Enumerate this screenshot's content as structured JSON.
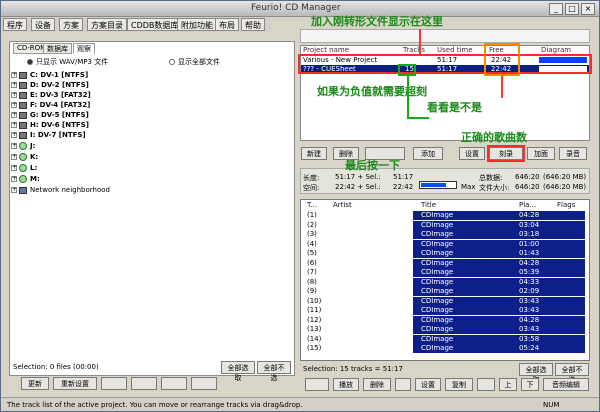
{
  "window_title": "Feurio! CD Manager",
  "menu": [
    "程序",
    "设备",
    "方案",
    "方案目录",
    "CDDB数据库",
    "附加功能",
    "布局",
    "帮助"
  ],
  "left_tabs": [
    "CD-ROM",
    "数据库",
    "观察"
  ],
  "left_options": [
    "只显示 WAV/MP3 文件",
    "显示全部文件"
  ],
  "drives": [
    {
      "letter": "C:",
      "label": "DV-1 [NTFS]"
    },
    {
      "letter": "D:",
      "label": "DV-2 [NTFS]"
    },
    {
      "letter": "E:",
      "label": "DV-3 [FAT32]"
    },
    {
      "letter": "F:",
      "label": "DV-4 [FAT32]"
    },
    {
      "letter": "G:",
      "label": "DV-5 [NTFS]"
    },
    {
      "letter": "H:",
      "label": "DV-6 [NTFS]"
    },
    {
      "letter": "I:",
      "label": "DV-7 [NTFS]"
    },
    {
      "letter": "J:",
      "label": ""
    },
    {
      "letter": "K:",
      "label": ""
    },
    {
      "letter": "L:",
      "label": ""
    },
    {
      "letter": "M:",
      "label": ""
    },
    {
      "letter": "Network neighborhood",
      "label": ""
    }
  ],
  "left_status": "Selection: 0 files (00:00)",
  "left_buttons": [
    "更新",
    "重新设置",
    "",
    "",
    "",
    "",
    "",
    "",
    "全部选取",
    "全部不选"
  ],
  "project_header": "Project name",
  "project_columns": [
    "Project name",
    "Tracks",
    "Used time",
    "Free",
    "Diagram"
  ],
  "project_rows": [
    {
      "name": "Various - New Project",
      "tracks": "",
      "used": "51:17",
      "free": "22:42"
    },
    {
      "name": "??? - CUESheet",
      "tracks": "15",
      "used": "51:17",
      "free": "22:42"
    }
  ],
  "mid_buttons": [
    "新建",
    "删除",
    "",
    "添加",
    "设置",
    "刻录",
    "加面",
    "录音"
  ],
  "mid_info": {
    "line1_label": "长度:",
    "line1_val": "51:17 + Sel.:",
    "line1_sel": "51:17",
    "line2_label": "空间:",
    "line2_val": "22:42 + Sel.:",
    "line2_sel": "22:42",
    "max_label": "Max",
    "r1_label": "总数据:",
    "r1_val": "646:20",
    "r1_unit": "(646:20 MB)",
    "r2_label": "文件大小:",
    "r2_val": "646:20",
    "r2_unit": "(646:20 MB)"
  },
  "track_columns": [
    "T...",
    "Artist",
    "Title",
    "Pla...",
    "Flags"
  ],
  "tracks": [
    {
      "n": "(1)",
      "title": "CDImage",
      "len": "04:28"
    },
    {
      "n": "(2)",
      "title": "CDImage",
      "len": "03:04"
    },
    {
      "n": "(3)",
      "title": "CDImage",
      "len": "03:18"
    },
    {
      "n": "(4)",
      "title": "CDImage",
      "len": "01:00"
    },
    {
      "n": "(5)",
      "title": "CDImage",
      "len": "01:43"
    },
    {
      "n": "(6)",
      "title": "CDImage",
      "len": "04:28"
    },
    {
      "n": "(7)",
      "title": "CDImage",
      "len": "05:39"
    },
    {
      "n": "(8)",
      "title": "CDImage",
      "len": "04:33"
    },
    {
      "n": "(9)",
      "title": "CDImage",
      "len": "02:09"
    },
    {
      "n": "(10)",
      "title": "CDImage",
      "len": "03:43"
    },
    {
      "n": "(11)",
      "title": "CDImage",
      "len": "03:43"
    },
    {
      "n": "(12)",
      "title": "CDImage",
      "len": "04:28"
    },
    {
      "n": "(13)",
      "title": "CDImage",
      "len": "03:43"
    },
    {
      "n": "(14)",
      "title": "CDImage",
      "len": "03:58"
    },
    {
      "n": "(15)",
      "title": "CDImage",
      "len": "05:24"
    }
  ],
  "track_status": "Selection: 15 tracks = 51:17",
  "track_select_all": "全部选取",
  "track_select_none": "全部不选",
  "track_buttons": [
    "",
    "播放",
    "删除",
    "",
    "设置",
    "复制",
    "",
    "上",
    "下",
    "音频编辑"
  ],
  "status_bar": "The track list of the active project. You can move or rearrange tracks via drag&drop.",
  "status_right": "NUM",
  "annotations": {
    "a1": "加入刚转形文件显示在这里",
    "a2": "如果为负值就需要超刻",
    "a3": "看看是不是",
    "a4": "正确的歌曲数",
    "a5": "最后按一下"
  },
  "colors": {
    "accent_red": "#ff2b2b",
    "accent_green": "#1aa81a",
    "accent_orange": "#ff8800",
    "selection": "#0c1f8a"
  }
}
